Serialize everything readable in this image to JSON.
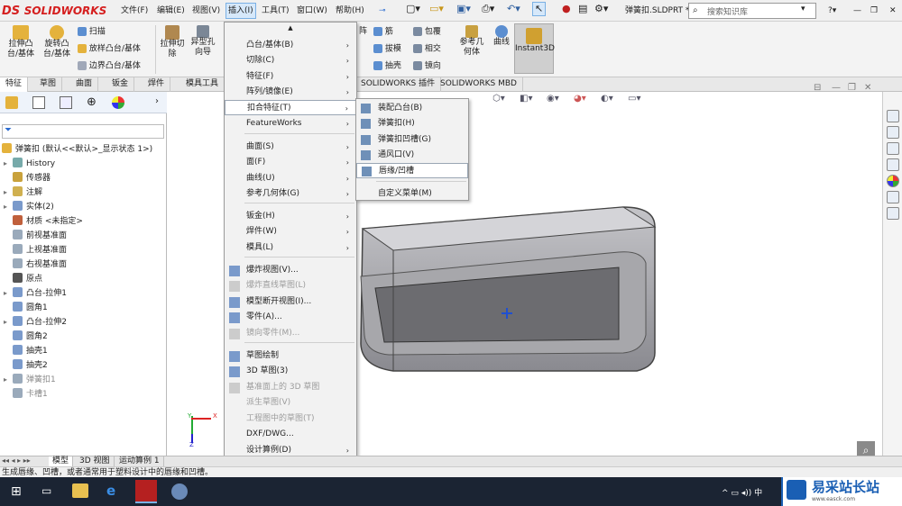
{
  "app": {
    "logo": "SOLIDWORKS",
    "document_title": "弹簧扣.SLDPRT *",
    "search_placeholder": "搜索知识库"
  },
  "menubar": [
    "文件(F)",
    "编辑(E)",
    "视图(V)",
    "插入(I)",
    "工具(T)",
    "窗口(W)",
    "帮助(H)"
  ],
  "ribbon": {
    "extrude_boss": "拉伸凸\n台/基体",
    "revolve_boss": "旋转凸\n台/基体",
    "sweep": "扫描",
    "loft_boss": "放样凸台/基体",
    "boundary_boss": "边界凸台/基体",
    "extrude_cut": "拉伸切\n除",
    "hole_wizard": "异型孔\n向导",
    "rib": "筋",
    "wrap": "包覆",
    "draft": "拔模",
    "intersect": "相交",
    "shell": "抽壳",
    "mirror": "镜向",
    "ref_geometry": "参考几\n何体",
    "curves": "曲线",
    "instant3d": "Instant3D",
    "array_fragment": "阵"
  },
  "command_tabs": [
    "特征",
    "草图",
    "曲面",
    "钣金",
    "焊件",
    "模具工具",
    "SOLIDWORKS 插件",
    "SOLIDWORKS MBD"
  ],
  "feature_tree": {
    "filter_icon": "filter-icon",
    "root": "弹簧扣 (默认<<默认>_显示状态 1>)",
    "items": [
      {
        "label": "History",
        "icon": "history-icon",
        "expand": true,
        "grey": false
      },
      {
        "label": "传感器",
        "icon": "sensor-icon",
        "expand": false,
        "grey": false
      },
      {
        "label": "注解",
        "icon": "annotation-icon",
        "expand": true,
        "grey": false
      },
      {
        "label": "实体(2)",
        "icon": "solid-body-icon",
        "expand": true,
        "grey": false
      },
      {
        "label": "材质 <未指定>",
        "icon": "material-icon",
        "expand": false,
        "grey": false
      },
      {
        "label": "前视基准面",
        "icon": "plane-icon",
        "expand": false,
        "grey": false
      },
      {
        "label": "上视基准面",
        "icon": "plane-icon",
        "expand": false,
        "grey": false
      },
      {
        "label": "右视基准面",
        "icon": "plane-icon",
        "expand": false,
        "grey": false
      },
      {
        "label": "原点",
        "icon": "origin-icon",
        "expand": false,
        "grey": false
      },
      {
        "label": "凸台-拉伸1",
        "icon": "extrude-icon",
        "expand": true,
        "grey": false
      },
      {
        "label": "圆角1",
        "icon": "fillet-icon",
        "expand": false,
        "grey": false
      },
      {
        "label": "凸台-拉伸2",
        "icon": "extrude-icon",
        "expand": true,
        "grey": false
      },
      {
        "label": "圆角2",
        "icon": "fillet-icon",
        "expand": false,
        "grey": false
      },
      {
        "label": "抽壳1",
        "icon": "shell-icon",
        "expand": false,
        "grey": false
      },
      {
        "label": "抽壳2",
        "icon": "shell-icon",
        "expand": false,
        "grey": false
      },
      {
        "label": "弹簧扣1",
        "icon": "snap-hook-icon",
        "expand": true,
        "grey": true
      },
      {
        "label": "卡槽1",
        "icon": "groove-icon",
        "expand": false,
        "grey": true
      }
    ]
  },
  "insert_menu": {
    "items": [
      {
        "label": "凸台/基体(B)",
        "submenu": true,
        "disabled": false
      },
      {
        "label": "切除(C)",
        "submenu": true,
        "disabled": false
      },
      {
        "label": "特征(F)",
        "submenu": true,
        "disabled": false
      },
      {
        "label": "阵列/镜像(E)",
        "submenu": true,
        "disabled": false
      },
      {
        "label": "扣合特征(T)",
        "submenu": true,
        "disabled": false,
        "highlight": true
      },
      {
        "label": "FeatureWorks",
        "submenu": true,
        "disabled": false
      },
      {
        "label": "曲面(S)",
        "submenu": true,
        "disabled": false
      },
      {
        "label": "面(F)",
        "submenu": true,
        "disabled": false
      },
      {
        "label": "曲线(U)",
        "submenu": true,
        "disabled": false
      },
      {
        "label": "参考几何体(G)",
        "submenu": true,
        "disabled": false
      },
      {
        "label": "钣金(H)",
        "submenu": true,
        "disabled": false
      },
      {
        "label": "焊件(W)",
        "submenu": true,
        "disabled": false
      },
      {
        "label": "模具(L)",
        "submenu": true,
        "disabled": false
      },
      {
        "label": "爆炸视图(V)...",
        "submenu": false,
        "disabled": false
      },
      {
        "label": "爆炸直线草图(L)",
        "submenu": false,
        "disabled": true
      },
      {
        "label": "模型断开视图(I)...",
        "submenu": false,
        "disabled": false
      },
      {
        "label": "零件(A)...",
        "submenu": false,
        "disabled": false
      },
      {
        "label": "镜向零件(M)...",
        "submenu": false,
        "disabled": true
      },
      {
        "label": "草图绘制",
        "submenu": false,
        "disabled": false
      },
      {
        "label": "3D 草图(3)",
        "submenu": false,
        "disabled": false
      },
      {
        "label": "基准面上的 3D 草图",
        "submenu": false,
        "disabled": true
      },
      {
        "label": "派生草图(V)",
        "submenu": false,
        "disabled": true
      },
      {
        "label": "工程图中的草图(T)",
        "submenu": false,
        "disabled": true
      },
      {
        "label": "DXF/DWG...",
        "submenu": false,
        "disabled": false
      },
      {
        "label": "设计算例(D)",
        "submenu": true,
        "disabled": false
      }
    ]
  },
  "fastening_submenu": {
    "items": [
      {
        "label": "装配凸台(B)",
        "icon": "mounting-boss-icon",
        "highlight": false
      },
      {
        "label": "弹簧扣(H)",
        "icon": "snap-hook-icon",
        "highlight": false
      },
      {
        "label": "弹簧扣凹槽(G)",
        "icon": "snap-hook-groove-icon",
        "highlight": false
      },
      {
        "label": "通风口(V)",
        "icon": "vent-icon",
        "highlight": false
      },
      {
        "label": "唇缘/凹槽",
        "icon": "lip-groove-icon",
        "highlight": true
      },
      {
        "label": "自定义菜单(M)",
        "icon": "",
        "highlight": false
      }
    ]
  },
  "bottom_tabs": [
    "模型",
    "3D 视图",
    "运动算例 1"
  ],
  "status_text": "生成唇缘、凹槽，或者通常用于塑料设计中的唇缘和凹槽。",
  "watermark": {
    "name": "易采站长站",
    "url": "www.easck.com"
  },
  "colors": {
    "brand_red": "#d51f1f",
    "accent_blue": "#1a5fb4",
    "taskbar": "#1b2433"
  }
}
